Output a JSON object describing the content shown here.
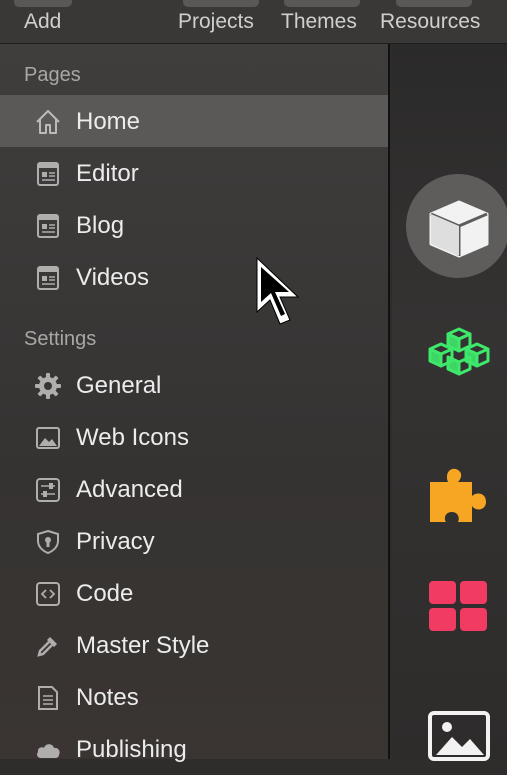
{
  "toolbar": {
    "items": [
      {
        "label": "Add"
      },
      {
        "label": "Projects"
      },
      {
        "label": "Themes"
      },
      {
        "label": "Resources"
      }
    ]
  },
  "sidebar": {
    "pages_header": "Pages",
    "pages": [
      {
        "label": "Home",
        "icon": "home-icon",
        "selected": true
      },
      {
        "label": "Editor",
        "icon": "page-icon"
      },
      {
        "label": "Blog",
        "icon": "page-icon"
      },
      {
        "label": "Videos",
        "icon": "page-icon"
      }
    ],
    "settings_header": "Settings",
    "settings": [
      {
        "label": "General",
        "icon": "gear-icon"
      },
      {
        "label": "Web Icons",
        "icon": "image-icon"
      },
      {
        "label": "Advanced",
        "icon": "sliders-icon"
      },
      {
        "label": "Privacy",
        "icon": "shield-icon"
      },
      {
        "label": "Code",
        "icon": "code-icon"
      },
      {
        "label": "Master Style",
        "icon": "eyedropper-icon"
      },
      {
        "label": "Notes",
        "icon": "notes-icon"
      },
      {
        "label": "Publishing",
        "icon": "cloud-icon"
      }
    ]
  },
  "right_panel": {
    "icons": [
      "cube-icon",
      "blocks-icon",
      "puzzle-icon",
      "grid-icon",
      "image-icon"
    ],
    "colors": {
      "blocks": "#3ee86a",
      "puzzle": "#f6a623",
      "grid": "#f23b62"
    }
  }
}
